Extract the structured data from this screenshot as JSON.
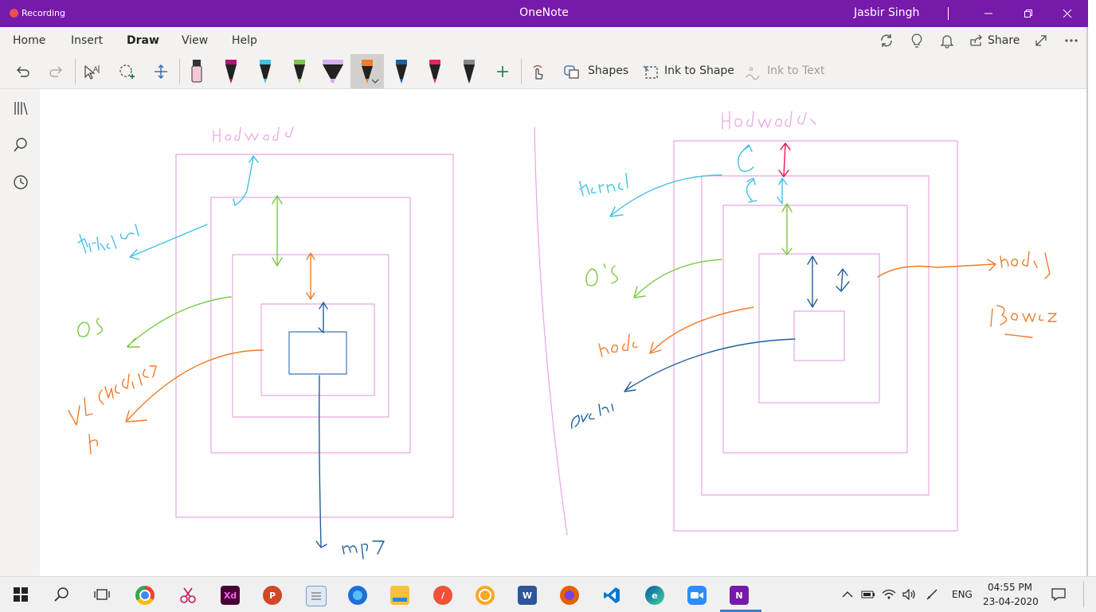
{
  "titlebar": {
    "recording_label": "Recording",
    "app_title": "OneNote",
    "user_name": "Jasbir Singh"
  },
  "menu": {
    "tabs": [
      "Home",
      "Insert",
      "Draw",
      "View",
      "Help"
    ],
    "active_tab": "Draw",
    "share_label": "Share"
  },
  "ribbon": {
    "shapes_label": "Shapes",
    "ink_to_shape_label": "Ink to Shape",
    "ink_to_text_label": "Ink to Text",
    "pens": [
      {
        "name": "highlighter-pen",
        "color": "#f5c8d8"
      },
      {
        "name": "magenta-pen",
        "color": "#b3127a"
      },
      {
        "name": "cyan-pen",
        "color": "#3bc1e6"
      },
      {
        "name": "green-pen",
        "color": "#7ac943"
      },
      {
        "name": "lavender-highlighter",
        "color": "#d6b0ee"
      },
      {
        "name": "orange-pen",
        "color": "#f07b2a"
      },
      {
        "name": "blue-pen",
        "color": "#1f5f9e"
      },
      {
        "name": "pink-pen",
        "color": "#e8245c"
      },
      {
        "name": "black-pen",
        "color": "#222222"
      }
    ],
    "selected_pen": "orange-pen"
  },
  "canvas": {
    "left_labels": {
      "hardware": "Hardware",
      "kernel": "Kernel",
      "os": "OS",
      "app": "VLC Media Player",
      "file": "mp4"
    },
    "right_labels": {
      "hardware": "Hardware",
      "kernel": "Kernel",
      "os": "OS",
      "runtime": "node",
      "app": "Actual",
      "tool": "nodejs",
      "browser": "Browser"
    },
    "ink_colors": {
      "pink": "#e8a6e0",
      "cyan": "#42c0e6",
      "green": "#7ac943",
      "orange": "#f07b2a",
      "blue": "#1f5f9e",
      "magenta": "#e8245c"
    }
  },
  "taskbar": {
    "apps": [
      "start",
      "search",
      "task-view",
      "chrome",
      "snip",
      "adobe-xd",
      "powerpoint",
      "notepad",
      "firefox",
      "file-explorer",
      "swift",
      "sublime",
      "word",
      "firefox-2",
      "vs-code",
      "edge",
      "zoom",
      "onenote"
    ],
    "language": "ENG",
    "time": "04:55 PM",
    "date": "23-04-2020"
  }
}
